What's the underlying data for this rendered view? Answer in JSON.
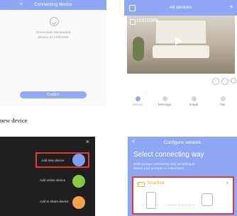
{
  "p1": {
    "title": "Connecting device",
    "back": "<",
    "status": "Connection succeeded",
    "device_line": "Device ID:11910269",
    "confirm": "Confirm"
  },
  "p2": {
    "title": "All devices",
    "add": "+",
    "camera_name": "11910269",
    "nav": [
      "Device",
      "Message",
      "Image",
      "My"
    ]
  },
  "caption": "new device",
  "p3": {
    "close": "×",
    "items": [
      {
        "label": "Add new device",
        "icon": "add-device-icon",
        "color": "#7f9ef2"
      },
      {
        "label": "Add online device",
        "icon": "online-device-icon",
        "color": "#8cc63f"
      },
      {
        "label": "Add to share device",
        "icon": "share-device-icon",
        "color": "#f5a04a"
      }
    ],
    "highlight_color": "#e53935"
  },
  "p4": {
    "title": "Configure network",
    "back": "<",
    "heading": "Select connecting way",
    "sub1": "Select proper connecting way according to",
    "sub2": "device your prompts or instructions",
    "option": "Smartlink",
    "arrow": ">",
    "accent": "#f5a623"
  },
  "colors": {
    "header_blue": "#8ea7f5",
    "dark_bg": "#1f1f1f",
    "highlight_red": "#e53935"
  }
}
